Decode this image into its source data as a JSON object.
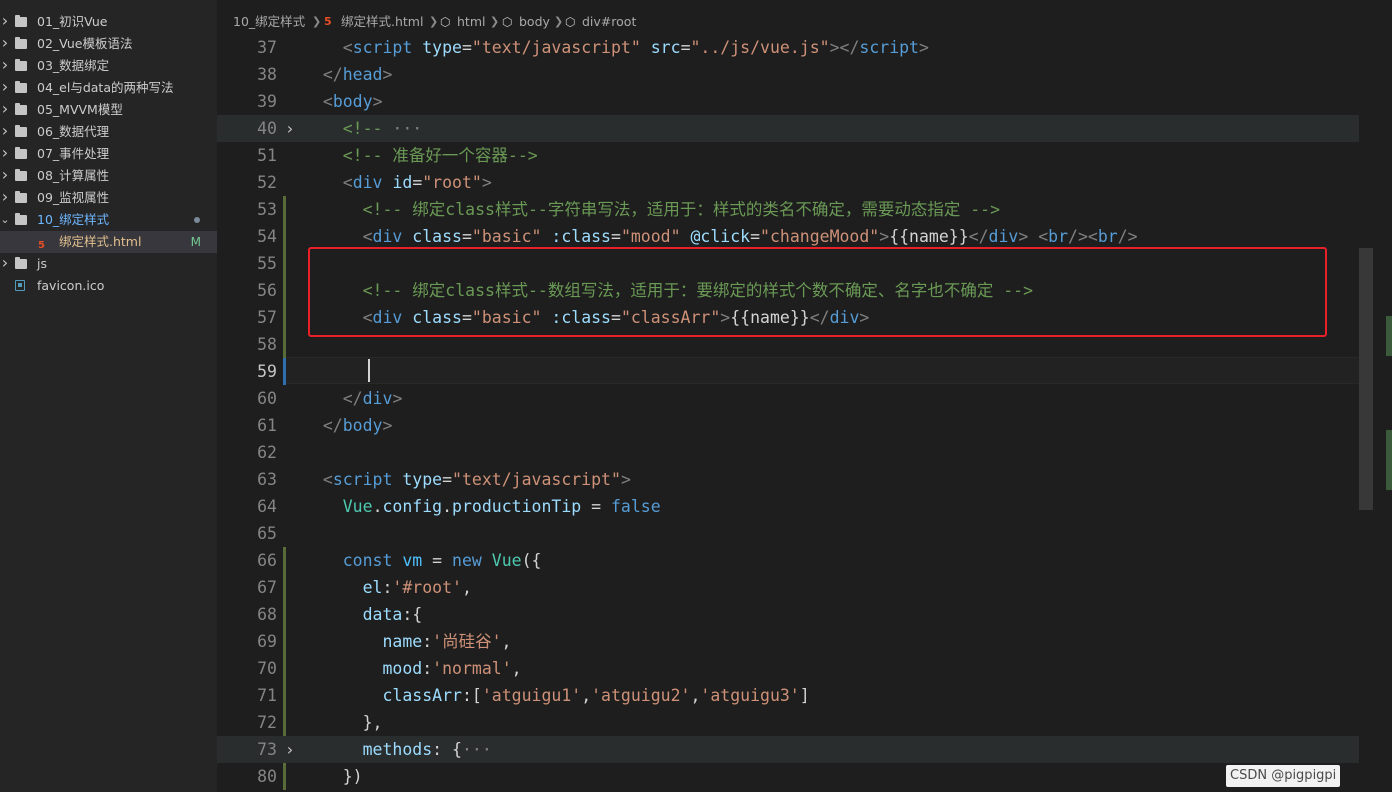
{
  "explorer": {
    "items": [
      {
        "label": "01_初识Vue"
      },
      {
        "label": "02_Vue模板语法"
      },
      {
        "label": "03_数据绑定"
      },
      {
        "label": "04_el与data的两种写法"
      },
      {
        "label": "05_MVVM模型"
      },
      {
        "label": "06_数据代理"
      },
      {
        "label": "07_事件处理"
      },
      {
        "label": "08_计算属性"
      },
      {
        "label": "09_监视属性"
      },
      {
        "label": "10_绑定样式"
      },
      {
        "label": "绑定样式.html",
        "status": "M"
      },
      {
        "label": "js"
      },
      {
        "label": "favicon.ico"
      }
    ]
  },
  "breadcrumb": {
    "items": [
      "10_绑定样式",
      "绑定样式.html",
      "html",
      "body",
      "div#root"
    ]
  },
  "editor": {
    "current_line": "59",
    "lines": [
      {
        "n": "37",
        "tokens": [
          [
            "pl",
            "    "
          ],
          [
            "br",
            "<"
          ],
          [
            "tag",
            "script"
          ],
          [
            "pl",
            " "
          ],
          [
            "attr",
            "type"
          ],
          [
            "pl",
            "="
          ],
          [
            "str",
            "\"text/javascript\""
          ],
          [
            "pl",
            " "
          ],
          [
            "attr",
            "src"
          ],
          [
            "pl",
            "="
          ],
          [
            "str",
            "\"../js/vue.js\""
          ],
          [
            "br",
            ">"
          ],
          [
            "br",
            "</"
          ],
          [
            "tag",
            "script"
          ],
          [
            "br",
            ">"
          ]
        ]
      },
      {
        "n": "38",
        "tokens": [
          [
            "pl",
            "  "
          ],
          [
            "br",
            "</"
          ],
          [
            "tag",
            "head"
          ],
          [
            "br",
            ">"
          ]
        ]
      },
      {
        "n": "39",
        "tokens": [
          [
            "pl",
            "  "
          ],
          [
            "br",
            "<"
          ],
          [
            "tag",
            "body"
          ],
          [
            "br",
            ">"
          ]
        ]
      },
      {
        "n": "40",
        "tokens": [
          [
            "pl",
            "    "
          ],
          [
            "cm",
            "<!-- "
          ],
          [
            "ell",
            "···"
          ]
        ]
      },
      {
        "n": "51",
        "tokens": [
          [
            "pl",
            "    "
          ],
          [
            "cm",
            "<!-- 准备好一个容器-->"
          ]
        ]
      },
      {
        "n": "52",
        "tokens": [
          [
            "pl",
            "    "
          ],
          [
            "br",
            "<"
          ],
          [
            "tag",
            "div"
          ],
          [
            "pl",
            " "
          ],
          [
            "attr",
            "id"
          ],
          [
            "pl",
            "="
          ],
          [
            "str",
            "\"root\""
          ],
          [
            "br",
            ">"
          ]
        ]
      },
      {
        "n": "53",
        "tokens": [
          [
            "pl",
            "      "
          ],
          [
            "cm",
            "<!-- 绑定class样式--字符串写法，适用于：样式的类名不确定，需要动态指定 -->"
          ]
        ]
      },
      {
        "n": "54",
        "tokens": [
          [
            "pl",
            "      "
          ],
          [
            "br",
            "<"
          ],
          [
            "tag",
            "div"
          ],
          [
            "pl",
            " "
          ],
          [
            "attr",
            "class"
          ],
          [
            "pl",
            "="
          ],
          [
            "str",
            "\"basic\""
          ],
          [
            "pl",
            " "
          ],
          [
            "attr",
            ":class"
          ],
          [
            "pl",
            "="
          ],
          [
            "str",
            "\"mood\""
          ],
          [
            "pl",
            " "
          ],
          [
            "attr",
            "@click"
          ],
          [
            "pl",
            "="
          ],
          [
            "str",
            "\"changeMood\""
          ],
          [
            "br",
            ">"
          ],
          [
            "pl",
            "{{name}}"
          ],
          [
            "br",
            "</"
          ],
          [
            "tag",
            "div"
          ],
          [
            "br",
            ">"
          ],
          [
            "pl",
            " "
          ],
          [
            "br",
            "<"
          ],
          [
            "tag",
            "br"
          ],
          [
            "br",
            "/>"
          ],
          [
            "br",
            "<"
          ],
          [
            "tag",
            "br"
          ],
          [
            "br",
            "/>"
          ]
        ]
      },
      {
        "n": "55",
        "tokens": []
      },
      {
        "n": "56",
        "tokens": [
          [
            "pl",
            "      "
          ],
          [
            "cm",
            "<!-- 绑定class样式--数组写法，适用于：要绑定的样式个数不确定、名字也不确定 -->"
          ]
        ]
      },
      {
        "n": "57",
        "tokens": [
          [
            "pl",
            "      "
          ],
          [
            "br",
            "<"
          ],
          [
            "tag",
            "div"
          ],
          [
            "pl",
            " "
          ],
          [
            "attr",
            "class"
          ],
          [
            "pl",
            "="
          ],
          [
            "str",
            "\"basic\""
          ],
          [
            "pl",
            " "
          ],
          [
            "attr",
            ":class"
          ],
          [
            "pl",
            "="
          ],
          [
            "str",
            "\"classArr\""
          ],
          [
            "br",
            ">"
          ],
          [
            "pl",
            "{{name}}"
          ],
          [
            "br",
            "</"
          ],
          [
            "tag",
            "div"
          ],
          [
            "br",
            ">"
          ]
        ]
      },
      {
        "n": "58",
        "tokens": []
      },
      {
        "n": "59",
        "tokens": []
      },
      {
        "n": "60",
        "tokens": [
          [
            "pl",
            "    "
          ],
          [
            "br",
            "</"
          ],
          [
            "tag",
            "div"
          ],
          [
            "br",
            ">"
          ]
        ]
      },
      {
        "n": "61",
        "tokens": [
          [
            "pl",
            "  "
          ],
          [
            "br",
            "</"
          ],
          [
            "tag",
            "body"
          ],
          [
            "br",
            ">"
          ]
        ]
      },
      {
        "n": "62",
        "tokens": []
      },
      {
        "n": "63",
        "tokens": [
          [
            "pl",
            "  "
          ],
          [
            "br",
            "<"
          ],
          [
            "tag",
            "script"
          ],
          [
            "pl",
            " "
          ],
          [
            "attr",
            "type"
          ],
          [
            "pl",
            "="
          ],
          [
            "str",
            "\"text/javascript\""
          ],
          [
            "br",
            ">"
          ]
        ]
      },
      {
        "n": "64",
        "tokens": [
          [
            "pl",
            "    "
          ],
          [
            "cls",
            "Vue"
          ],
          [
            "pl",
            "."
          ],
          [
            "prop",
            "config"
          ],
          [
            "pl",
            "."
          ],
          [
            "prop",
            "productionTip"
          ],
          [
            "pl",
            " = "
          ],
          [
            "lit",
            "false"
          ]
        ]
      },
      {
        "n": "65",
        "tokens": []
      },
      {
        "n": "66",
        "tokens": [
          [
            "pl",
            "    "
          ],
          [
            "kw",
            "const"
          ],
          [
            "pl",
            " "
          ],
          [
            "var",
            "vm"
          ],
          [
            "pl",
            " = "
          ],
          [
            "kw",
            "new"
          ],
          [
            "pl",
            " "
          ],
          [
            "cls",
            "Vue"
          ],
          [
            "pl",
            "({"
          ]
        ]
      },
      {
        "n": "67",
        "tokens": [
          [
            "pl",
            "      "
          ],
          [
            "prop",
            "el"
          ],
          [
            "pl",
            ":"
          ],
          [
            "str",
            "'#root'"
          ],
          [
            "pl",
            ","
          ]
        ]
      },
      {
        "n": "68",
        "tokens": [
          [
            "pl",
            "      "
          ],
          [
            "prop",
            "data"
          ],
          [
            "pl",
            ":{"
          ]
        ]
      },
      {
        "n": "69",
        "tokens": [
          [
            "pl",
            "        "
          ],
          [
            "prop",
            "name"
          ],
          [
            "pl",
            ":"
          ],
          [
            "str",
            "'尚硅谷'"
          ],
          [
            "pl",
            ","
          ]
        ]
      },
      {
        "n": "70",
        "tokens": [
          [
            "pl",
            "        "
          ],
          [
            "prop",
            "mood"
          ],
          [
            "pl",
            ":"
          ],
          [
            "str",
            "'normal'"
          ],
          [
            "pl",
            ","
          ]
        ]
      },
      {
        "n": "71",
        "tokens": [
          [
            "pl",
            "        "
          ],
          [
            "prop",
            "classArr"
          ],
          [
            "pl",
            ":["
          ],
          [
            "str",
            "'atguigu1'"
          ],
          [
            "pl",
            ","
          ],
          [
            "str",
            "'atguigu2'"
          ],
          [
            "pl",
            ","
          ],
          [
            "str",
            "'atguigu3'"
          ],
          [
            "pl",
            "]"
          ]
        ]
      },
      {
        "n": "72",
        "tokens": [
          [
            "pl",
            "      "
          ],
          [
            "pl",
            "},"
          ]
        ]
      },
      {
        "n": "73",
        "tokens": [
          [
            "pl",
            "      "
          ],
          [
            "prop",
            "methods"
          ],
          [
            "pl",
            ": {"
          ],
          [
            "ell",
            "···"
          ]
        ]
      },
      {
        "n": "80",
        "tokens": [
          [
            "pl",
            "    "
          ],
          [
            "pl",
            "})"
          ]
        ]
      }
    ]
  },
  "watermark": "CSDN @pigpigpi",
  "colors": {
    "sidebar_bg": "#252526",
    "editor_bg": "#1e1e1e",
    "highlight_box": "#e8202a",
    "modified": "#73c991"
  }
}
